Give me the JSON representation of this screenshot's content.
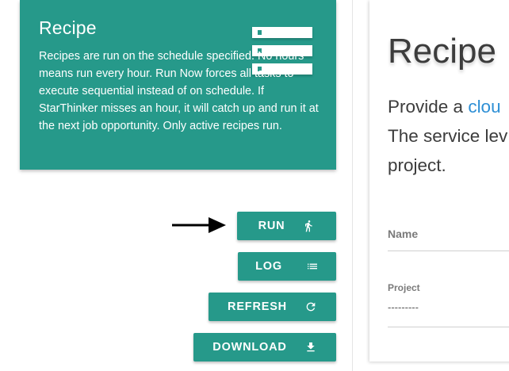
{
  "info": {
    "title": "Recipe",
    "text": "Recipes are run on the schedule specified. No hours means run every hour. Run Now forces all tasks to execute sequential instead of on schedule. If StarThinker misses an hour, it will catch up and run it at the next job opportunity. Only active recipes run.",
    "icon": "list-icon"
  },
  "buttons": {
    "run": "RUN",
    "log": "LOG",
    "refresh": "REFRESH",
    "download": "DOWNLOAD"
  },
  "form": {
    "title": "Recipe",
    "desc_prefix": "Provide a ",
    "desc_link": "clou",
    "desc_line2": "The service lev",
    "desc_line3": "project.",
    "name_label": "Name",
    "project_label": "Project",
    "project_value": "---------"
  },
  "colors": {
    "accent": "#26998a",
    "link": "#2d8fd5"
  }
}
